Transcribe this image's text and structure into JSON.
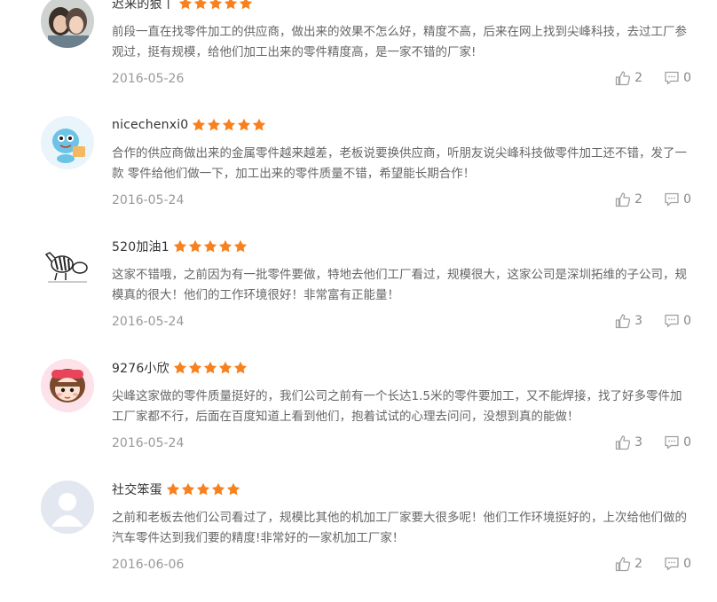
{
  "reviews": [
    {
      "username": "迟来的狠丨",
      "rating": 5,
      "content": "前段一直在找零件加工的供应商，做出来的效果不怎么好，精度不高，后来在网上找到尖峰科技，去过工厂参观过，挺有规模，给他们加工出来的零件精度高，是一家不错的厂家!",
      "date": "2016-05-26",
      "likes": "2",
      "comments": "0",
      "avatar": "couple-photo-avatar"
    },
    {
      "username": "nicechenxi0",
      "rating": 5,
      "content": "合作的供应商做出来的金属零件越来越差，老板说要换供应商，听朋友说尖峰科技做零件加工还不错，发了一款 零件给他们做一下，加工出来的零件质量不错，希望能长期合作！",
      "date": "2016-05-24",
      "likes": "2",
      "comments": "0",
      "avatar": "cartoon-creature-avatar"
    },
    {
      "username": "520加油1",
      "rating": 5,
      "content": "这家不错哦，之前因为有一批零件要做，特地去他们工厂看过，规模很大，这家公司是深圳拓维的子公司，规模真的很大！他们的工作环境很好！非常富有正能量！",
      "date": "2016-05-24",
      "likes": "3",
      "comments": "0",
      "avatar": "zebra-sketch-avatar"
    },
    {
      "username": "9276小欣",
      "rating": 5,
      "content": "尖峰这家做的零件质量挺好的，我们公司之前有一个长达1.5米的零件要加工，又不能焊接，找了好多零件加工厂家都不行，后面在百度知道上看到他们，抱着试试的心理去问问，没想到真的能做！",
      "date": "2016-05-24",
      "likes": "3",
      "comments": "0",
      "avatar": "cartoon-girl-avatar"
    },
    {
      "username": "社交笨蛋",
      "rating": 5,
      "content": "之前和老板去他们公司看过了，规模比其他的机加工厂家要大很多呢！他们工作环境挺好的，上次给他们做的汽车零件达到我们要的精度!非常好的一家机加工厂家！",
      "date": "2016-06-06",
      "likes": "2",
      "comments": "0",
      "avatar": "default-user-avatar"
    }
  ],
  "colors": {
    "star": "#f7811e",
    "text": "#666666",
    "meta": "#999999",
    "icon": "#a0a0a0"
  },
  "icons": {
    "like": "thumbs-up-icon",
    "comment": "comment-icon",
    "star": "star-icon"
  }
}
